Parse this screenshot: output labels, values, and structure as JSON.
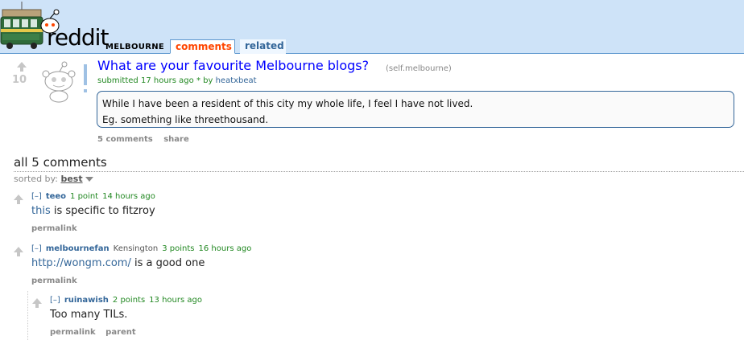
{
  "header": {
    "logo_text": "reddit",
    "subreddit": "MELBOURNE",
    "tabs": [
      {
        "label": "comments",
        "selected": true
      },
      {
        "label": "related",
        "selected": false
      }
    ],
    "colors": {
      "background": "#cee3f8",
      "active_tab": "#ff4500",
      "tab_text": "#336699"
    }
  },
  "post": {
    "score": "10",
    "title": "What are your favourite Melbourne blogs?",
    "domain": "(self.melbourne)",
    "tagline": {
      "prefix": "submitted",
      "time": "17 hours ago",
      "separator": "*",
      "by": "by",
      "author": "heatxbeat"
    },
    "selftext": [
      "While I have been a resident of this city my whole life, I feel I have not lived.",
      "Eg. something like threethousand."
    ],
    "buttons": {
      "comments": "5 comments",
      "share": "share"
    },
    "thumbnail_icon": "reddit-alien-thumbnail-icon"
  },
  "comments_area": {
    "header": "all 5 comments",
    "sorted_by_label": "sorted by:",
    "sorted_by_value": "best",
    "comments": [
      {
        "expand": "[–]",
        "author": "teeo",
        "flair": "",
        "score": "1 point",
        "time": "14 hours ago",
        "body_link": "this",
        "body_text": " is specific to fitzroy",
        "buttons": [
          "permalink"
        ]
      },
      {
        "expand": "[–]",
        "author": "melbournefan",
        "flair": "Kensington",
        "score": "3 points",
        "time": "16 hours ago",
        "body_link": "http://wongm.com/",
        "body_text": " is a good one",
        "buttons": [
          "permalink"
        ]
      },
      {
        "expand": "[–]",
        "author": "ruinawish",
        "flair": "",
        "score": "2 points",
        "time": "13 hours ago",
        "body_link": "",
        "body_text": "Too many TILs.",
        "buttons": [
          "permalink",
          "parent"
        ]
      }
    ]
  }
}
